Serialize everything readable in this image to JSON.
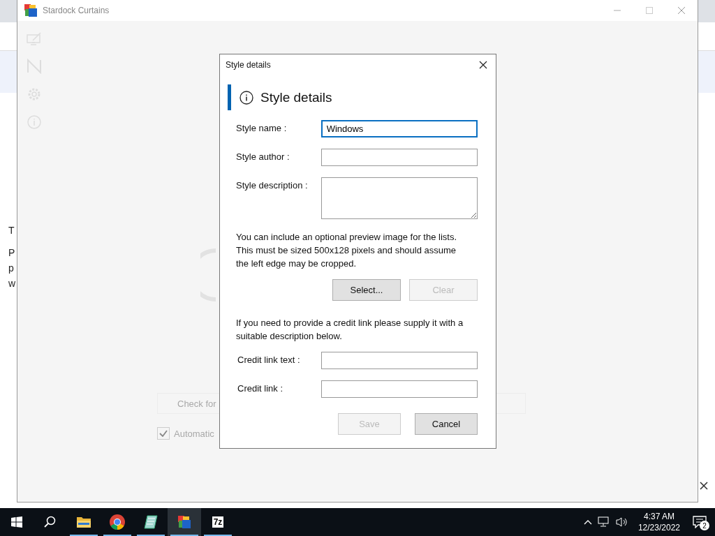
{
  "browser": {
    "fragments": [
      "T",
      "P",
      "p",
      "w"
    ]
  },
  "app_window": {
    "title": "Stardock Curtains",
    "check_button": "Check for",
    "auto_update": {
      "label": "Automatic",
      "checked": true
    }
  },
  "dialog": {
    "title": "Style details",
    "heading": "Style details",
    "fields": [
      {
        "label": "Style name :",
        "value": "Windows",
        "kind": "line",
        "focused": true
      },
      {
        "label": "Style author :",
        "kind": "line",
        "focused": false
      },
      {
        "label": "Style description :",
        "kind": "area",
        "focused": false
      }
    ],
    "preview_note": "You can include an optional preview image for the lists. This must be sized 500x128 pixels and should assume the left edge may be cropped.",
    "preview_buttons": [
      {
        "label": "Select...",
        "disabled": false
      },
      {
        "label": "Clear",
        "disabled": true
      }
    ],
    "credit_note": "If you need to provide a credit link please supply it with a suitable description below.",
    "credit_fields": [
      {
        "label": "Credit link text :"
      },
      {
        "label": "Credit link :"
      }
    ],
    "buttons": [
      {
        "label": "Save",
        "disabled": true
      },
      {
        "label": "Cancel",
        "disabled": false
      }
    ]
  },
  "taskbar": {
    "apps": [
      {
        "kind": "folder",
        "selected": false
      },
      {
        "kind": "browser",
        "selected": false
      },
      {
        "kind": "editor",
        "selected": false
      },
      {
        "kind": "curtains",
        "selected": true
      },
      {
        "kind": "archive",
        "label": "7z",
        "selected": false
      }
    ],
    "time": "4:37 AM",
    "date": "12/23/2022",
    "notification_count": "2"
  }
}
